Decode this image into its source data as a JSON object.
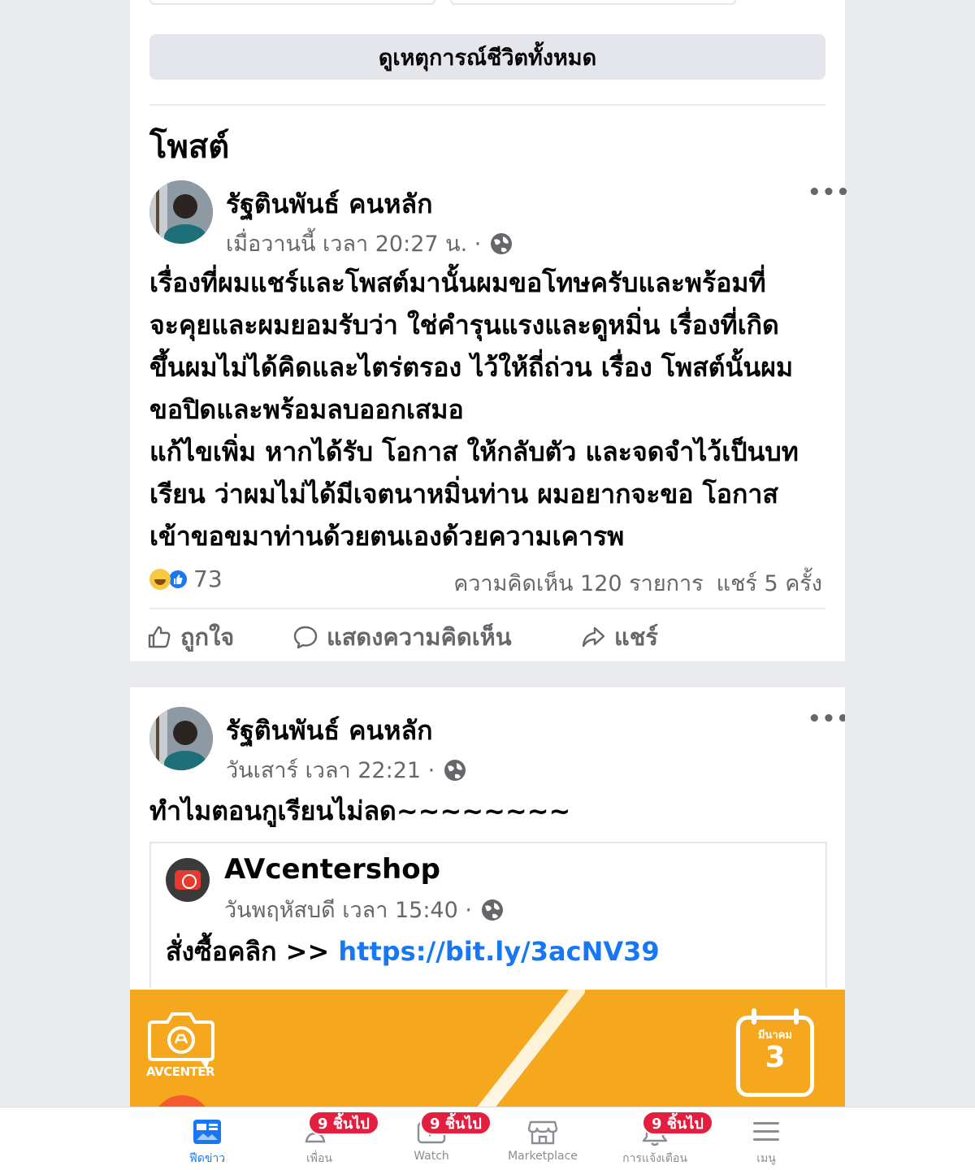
{
  "profile": {
    "see_all_button": "ดูเหตุการณ์ชีวิตทั้งหมด",
    "posts_section_title": "โพสต์"
  },
  "posts": [
    {
      "author": "รัฐตินพันธ์ คนหลัก",
      "timestamp": "เมื่อวานนี้ เวลา 20:27 น. ·",
      "privacy_icon": "globe-icon",
      "body_lines": [
        "เรื่องที่ผมแชร์และโพสต์มานั้นผมขอโทษครับและพร้อมที่",
        "จะคุยและผมยอมรับว่า ใช่คำรุนแรงและดูหมิ่น เรื่องที่เกิด",
        "ขึ้นผมไม่ได้คิดและไตร่ตรอง ไว้ให้ถี่ถ่วน เรื่อง โพสต์นั้นผม",
        "ขอปิดและพร้อมลบออกเสมอ",
        "แก้ไขเพิ่ม หากได้รับ โอกาส ให้กลับตัว และจดจำไว้เป็นบท",
        "เรียน ว่าผมไม่ได้มีเจตนาหมิ่นท่าน ผมอยากจะขอ โอกาส",
        "เข้าขอขมาท่านด้วยตนเองด้วยความเคารพ"
      ],
      "reaction_count": "73",
      "comments": "ความคิดเห็น 120 รายการ",
      "shares": "แชร์ 5 ครั้ง",
      "actions": {
        "like": "ถูกใจ",
        "comment": "แสดงความคิดเห็น",
        "share": "แชร์"
      }
    },
    {
      "author": "รัฐตินพันธ์ คนหลัก",
      "timestamp": "วันเสาร์ เวลา 22:21 ·",
      "privacy_icon": "globe-icon",
      "body": "ทำไมตอนกูเรียนไม่ลด~~~~~~~~",
      "shared_post": {
        "page_name": "AVcentershop",
        "timestamp": "วันพฤหัสบดี เวลา 15:40 ·",
        "text_prefix": "สั่งซื้อคลิก >>",
        "link": "https://bit.ly/3acNV39",
        "banner": {
          "logo_text": "AVCENTER",
          "calendar_month": "มีนาคม",
          "calendar_day": "3",
          "background_color": "#f5a71d"
        }
      }
    }
  ],
  "tabbar": {
    "tabs": [
      {
        "label": "ฟีดข่าว",
        "icon": "news-feed-icon",
        "active": true
      },
      {
        "label": "เพื่อน",
        "icon": "friends-icon",
        "badge": "9 ชิ้นไป"
      },
      {
        "label": "Watch",
        "icon": "watch-icon",
        "badge": "9 ชิ้นไป"
      },
      {
        "label": "Marketplace",
        "icon": "marketplace-icon"
      },
      {
        "label": "การแจ้งเตือน",
        "icon": "bell-icon",
        "badge": "9 ชิ้นไป"
      },
      {
        "label": "เมนู",
        "icon": "menu-icon"
      }
    ]
  },
  "colors": {
    "accent": "#1877f2",
    "badge": "#e41e3f",
    "secondary_text": "#65676b"
  }
}
